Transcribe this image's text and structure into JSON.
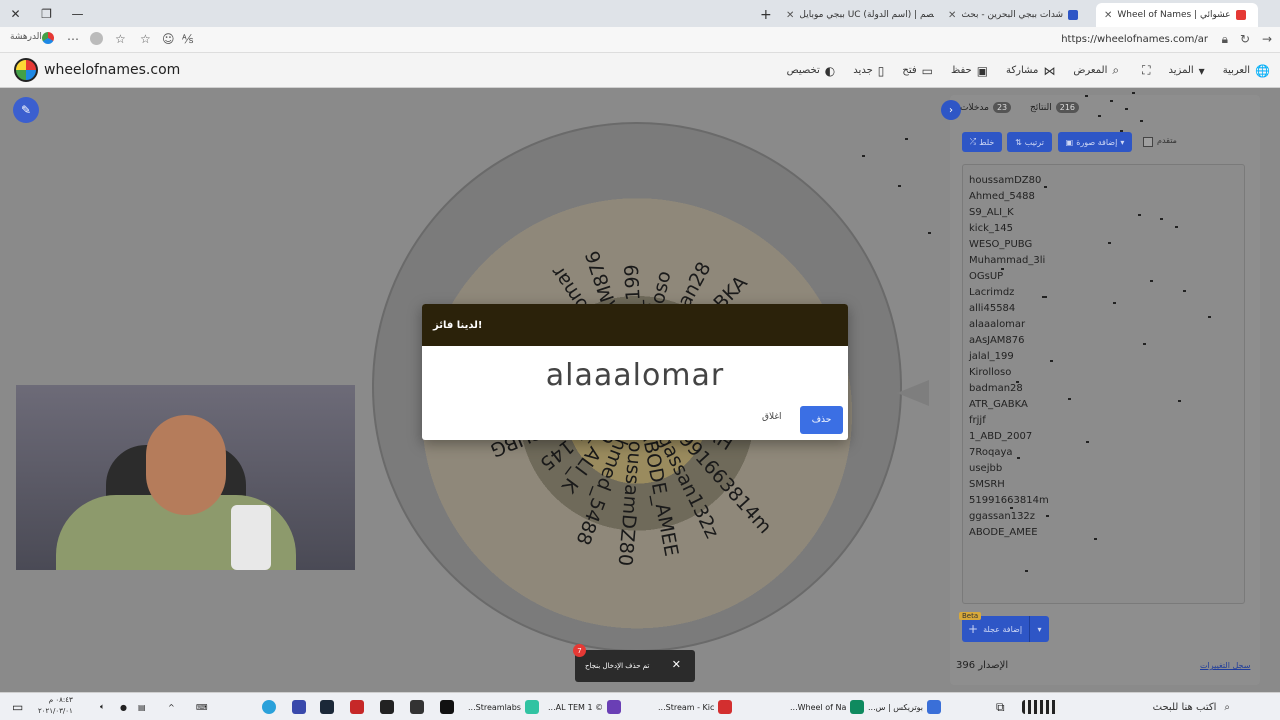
{
  "browser": {
    "tabs": [
      {
        "title": "Wheel of Names | عشوائي",
        "active": true
      },
      {
        "title": "شدات ببجي البحرين - بحث"
      },
      {
        "title": "ببجي موبايل UC (اسم الدولة) | خصم"
      }
    ],
    "url": "https://wheelofnames.com/ar",
    "profile_label": "الدرهشة"
  },
  "app": {
    "brand": "wheelofnames.com",
    "menu": [
      {
        "label": "العربية",
        "icon": "globe-icon",
        "glyph": "🌐"
      },
      {
        "label": "المزيد",
        "icon": "chevron-down-icon",
        "glyph": "▾"
      },
      {
        "label": "",
        "icon": "fullscreen-icon",
        "glyph": "⛶"
      },
      {
        "label": "المعرض",
        "icon": "search-icon",
        "glyph": "⌕"
      },
      {
        "label": "مشاركة",
        "icon": "share-icon",
        "glyph": "⋈"
      },
      {
        "label": "حفظ",
        "icon": "save-icon",
        "glyph": "▣"
      },
      {
        "label": "فتح",
        "icon": "folder-icon",
        "glyph": "▭"
      },
      {
        "label": "جديد",
        "icon": "new-file-icon",
        "glyph": "▯"
      },
      {
        "label": "تخصيص",
        "icon": "palette-icon",
        "glyph": "◐"
      }
    ]
  },
  "wheel": {
    "labels": [
      "houssamDZ80",
      "Ahmed_5488",
      "S9_ALI_K",
      "kick_145",
      "WESO_PUBG",
      "Muhammad_3li",
      "OGsUP",
      "Lacrimdz",
      "alli45584",
      "alaaalomar",
      "aAsJAM876",
      "jalal_199",
      "Kirolloso",
      "badman28",
      "ATR_GABKA",
      "frjjf",
      "1_ABD_2007",
      "7Roqaya",
      "usejbb",
      "SMSRH",
      "51991663814m",
      "ggassan132z",
      "ABODE_AMEE"
    ]
  },
  "panel": {
    "tabs": [
      {
        "label": "مدخلات",
        "count": "23"
      },
      {
        "label": "النتائج",
        "count": "216"
      }
    ],
    "buttons": {
      "shuffle": "خلط",
      "sort": "ترتيب",
      "add_image": "إضافة صورة",
      "advanced": "متقدم"
    },
    "entries": [
      "houssamDZ80",
      "Ahmed_5488",
      "S9_ALI_K",
      "kick_145",
      "WESO_PUBG",
      "Muhammad_3li",
      "OGsUP",
      "Lacrimdz",
      "alli45584",
      "alaaalomar",
      "aAsJAM876",
      "jalal_199",
      "Kirolloso",
      "badman28",
      "ATR_GABKA",
      "frjjf",
      "1_ABD_2007",
      "7Roqaya",
      "usejbb",
      "SMSRH",
      "51991663814m",
      "ggassan132z",
      "ABODE_AMEE"
    ],
    "add_wheel": "إضافة عجلة",
    "beta": "Beta",
    "version": "الإصدار 396",
    "changelog": "سجل التغييرات"
  },
  "dialog": {
    "title": "لدينا فائز!",
    "winner": "alaaalomar",
    "close": "اغلاق",
    "remove": "حذف"
  },
  "toast": {
    "message": "تم حذف الإدخال بنجاح",
    "count": "7"
  },
  "taskbar": {
    "search": "اكتب هنا للبحث",
    "time": "٠٨:٤٣ م",
    "date": "٢٠٢١/٠٣/٠١",
    "apps": [
      {
        "label": "...بوتريكس | س",
        "color": "#3a6fd8"
      },
      {
        "label": "...Wheel of Na",
        "color": "#0f8a5f"
      },
      {
        "label": "...Stream - Kic",
        "color": "#d32f2f"
      },
      {
        "label": "...AL TEM 1 ©",
        "color": "#6a3fb5"
      },
      {
        "label": "...Streamlabs",
        "color": "#31c3a2"
      }
    ]
  },
  "colors": {
    "accent": "#2e56c6",
    "dialog_header": "#2b220a",
    "remove_button": "#3b6fe4"
  }
}
